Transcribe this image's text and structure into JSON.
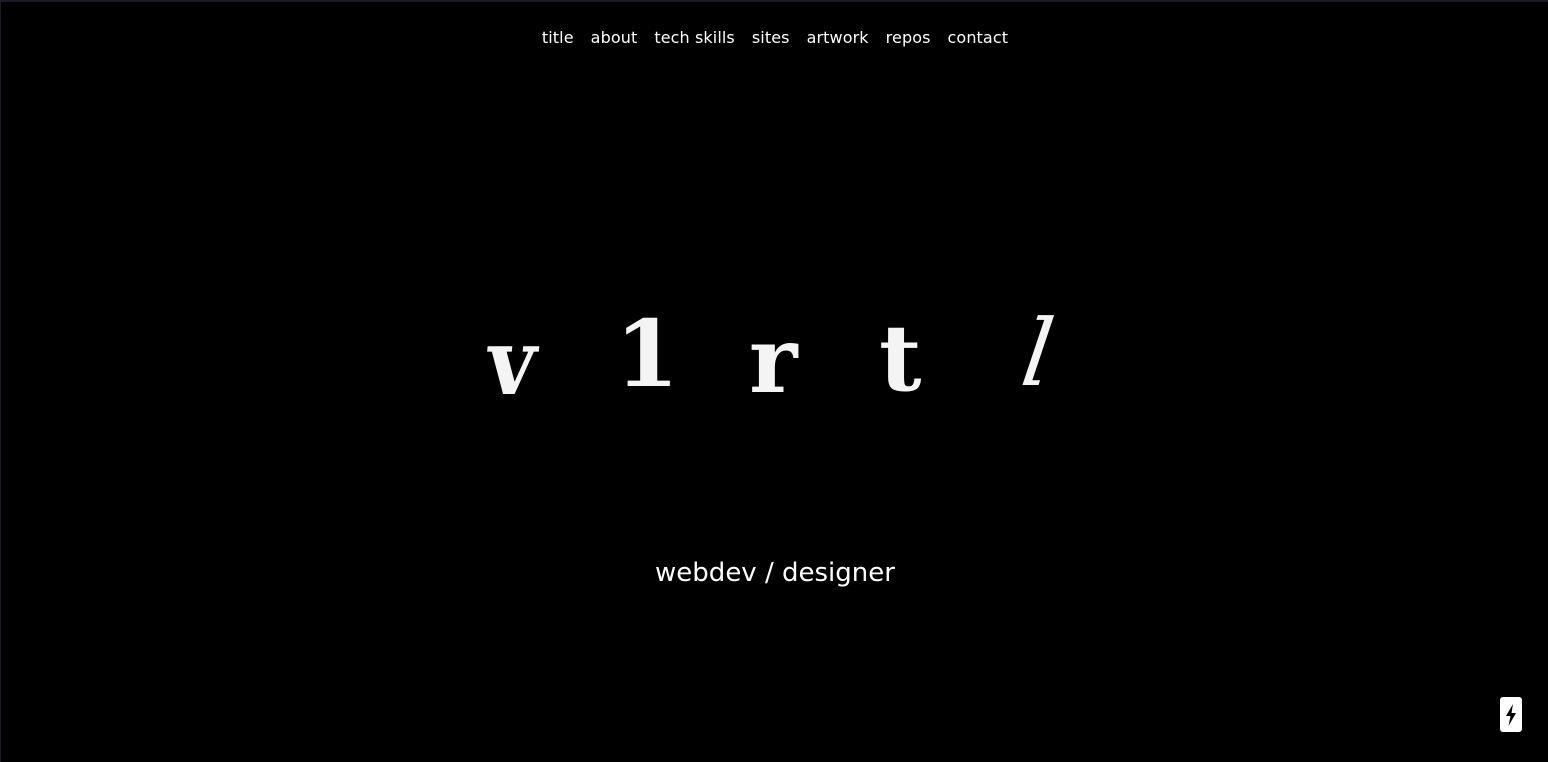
{
  "nav": {
    "items": [
      {
        "label": "title"
      },
      {
        "label": "about"
      },
      {
        "label": "tech skills"
      },
      {
        "label": "sites"
      },
      {
        "label": "artwork"
      },
      {
        "label": "repos"
      },
      {
        "label": "contact"
      }
    ]
  },
  "hero": {
    "logo_letters": [
      "v",
      "1",
      "r",
      "t",
      "l"
    ],
    "tagline": "webdev / designer"
  },
  "corner_button": {
    "icon": "lightning-bolt-icon"
  },
  "colors": {
    "background": "#000000",
    "text": "#ffffff",
    "frame": "#1c1a2a"
  }
}
